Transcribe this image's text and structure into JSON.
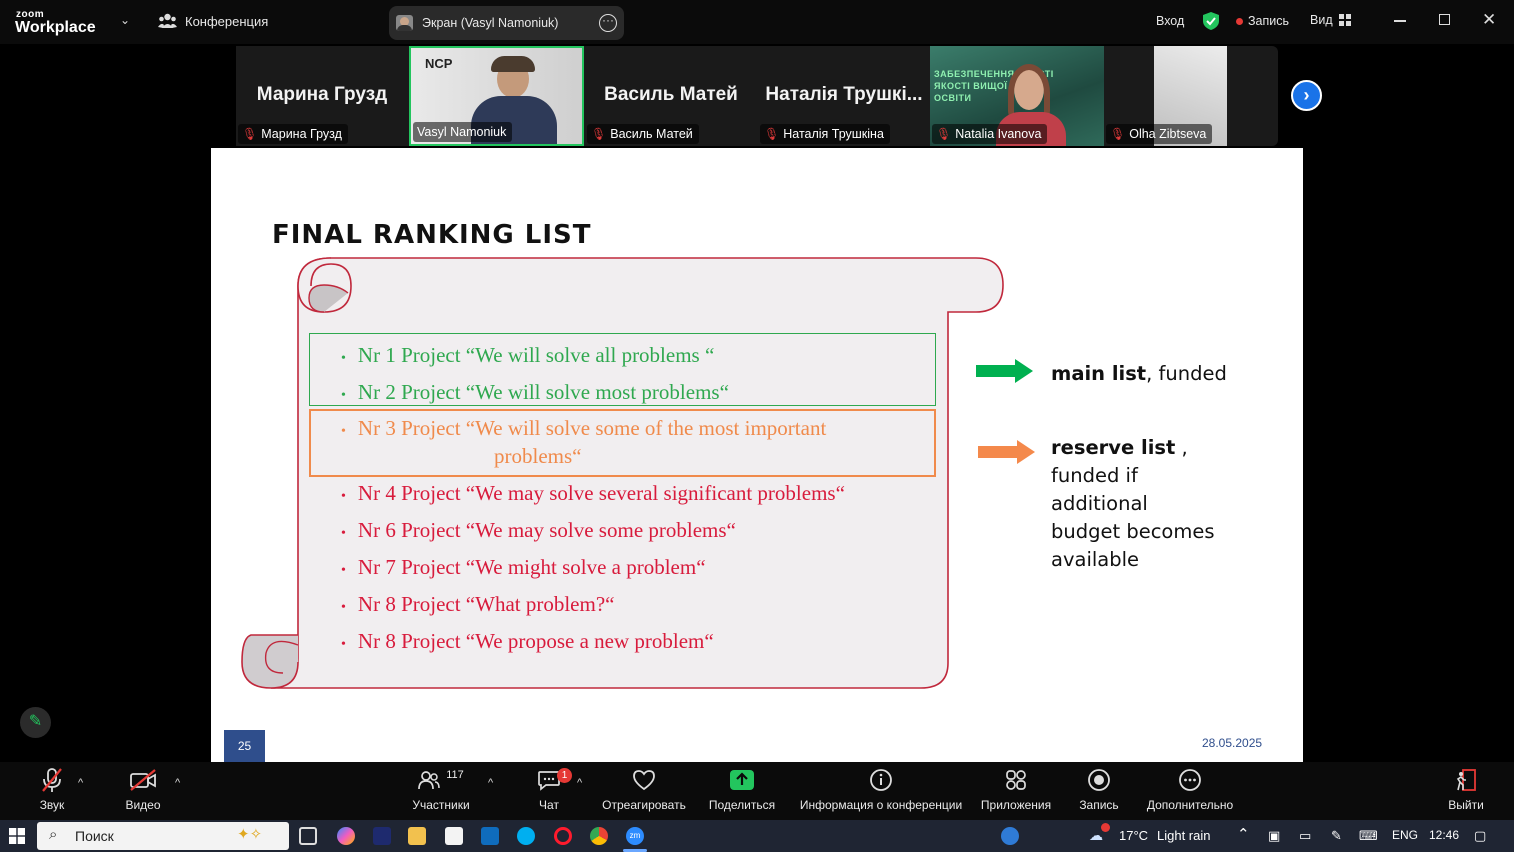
{
  "app": {
    "logo_small": "zoom",
    "logo_big": "Workplace",
    "meeting_menu": "Конференция"
  },
  "screen_share": {
    "label": "Экран (Vasyl Namoniuk)"
  },
  "top_right": {
    "signin": "Вход",
    "recording": "Запись",
    "view": "Вид"
  },
  "gallery": [
    {
      "big_name": "Марина Грузд",
      "label": "Марина Грузд",
      "muted": true
    },
    {
      "big_name": "",
      "label": "Vasyl Namoniuk",
      "muted": false,
      "video": true,
      "active": true,
      "logo": "NCP"
    },
    {
      "big_name": "Василь Матей",
      "label": "Василь Матей",
      "muted": true
    },
    {
      "big_name": "Наталія Трушкі...",
      "label": "Наталія Трушкіна",
      "muted": true
    },
    {
      "big_name": "",
      "label": "Natalia Ivanova",
      "muted": true,
      "video": true,
      "banner": "ЗАБЕЗПЕЧЕННЯ ЯКОСТІ... ВИЩОЇ ОСВІТИ",
      "banner_lines": [
        "ЗАБЕЗПЕЧЕННЯ ЯКОСТІ",
        "ЯКОСТІ ВИЩОЇ",
        "ОСВІТИ"
      ]
    },
    {
      "big_name": "",
      "label": "Olha Zibtseva",
      "muted": true,
      "video": true
    }
  ],
  "slide": {
    "title": "FINAL RANKING LIST",
    "items": [
      {
        "text": "Nr 1 Project “We will solve all problems “",
        "color": "#2fa84f"
      },
      {
        "text": "Nr 2 Project “We will solve most problems“",
        "color": "#2fa84f"
      },
      {
        "text": "Nr 3 Project  “We will solve some of the most important",
        "cont": "problems“",
        "color": "#f08a4b"
      },
      {
        "text": "Nr 4 Project  “We may solve several significant problems“",
        "color": "#d81b3c"
      },
      {
        "text": "Nr 6 Project  “We may solve some problems“",
        "color": "#d81b3c"
      },
      {
        "text": "Nr 7 Project  “We might solve a problem“",
        "color": "#d81b3c"
      },
      {
        "text": "Nr 8 Project   “What problem?“",
        "color": "#d81b3c"
      },
      {
        "text": "Nr 8 Project   “We propose a new problem“",
        "color": "#d81b3c"
      }
    ],
    "legend": {
      "main_bold": "main list",
      "main_rest": ", funded",
      "reserve_bold": "reserve list",
      "reserve_rest": " ,",
      "reserve_lines": [
        "funded if",
        "additional",
        "budget becomes",
        "available"
      ]
    },
    "page_number": "25",
    "date": "28.05.2025",
    "colors": {
      "green": "#00b050",
      "orange": "#f4894b",
      "scroll_border": "#c0283c"
    }
  },
  "toolbar": {
    "audio": "Звук",
    "video": "Видео",
    "participants": "Участники",
    "participants_count": "117",
    "chat": "Чат",
    "chat_badge": "1",
    "react": "Отреагировать",
    "share": "Поделиться",
    "info": "Информация о конференции",
    "apps": "Приложения",
    "record": "Запись",
    "more": "Дополнительно",
    "leave": "Выйти"
  },
  "taskbar": {
    "search_placeholder": "Поиск",
    "weather_temp": "17°C",
    "weather_text": "Light rain",
    "lang": "ENG",
    "time": "12:46"
  }
}
